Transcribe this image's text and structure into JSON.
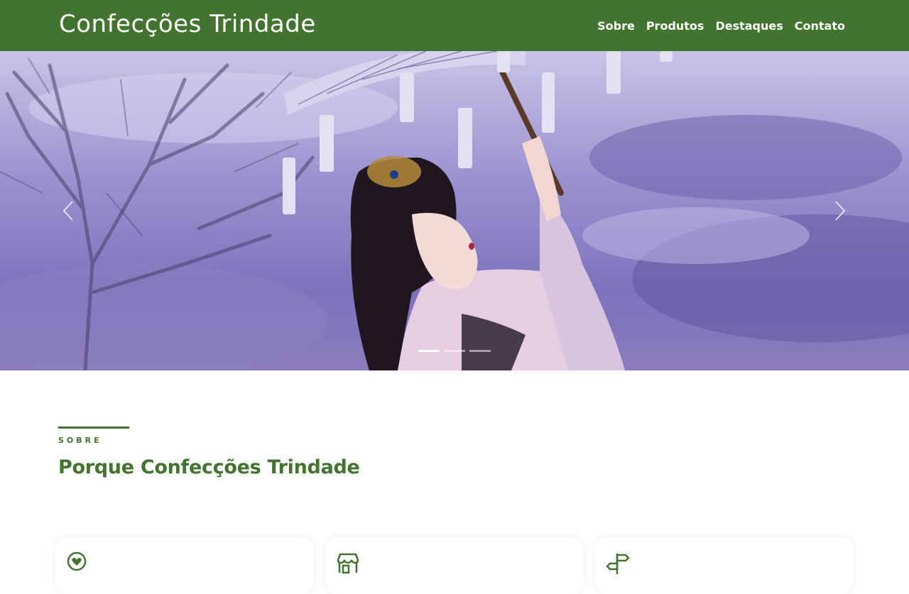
{
  "header": {
    "brand": "Confecções Trindade",
    "nav": [
      {
        "label": "Sobre"
      },
      {
        "label": "Produtos"
      },
      {
        "label": "Destaques"
      },
      {
        "label": "Contato"
      }
    ]
  },
  "hero": {
    "slides_count": 3,
    "active_slide": 1,
    "prev_icon": "chevron-left-icon",
    "next_icon": "chevron-right-icon"
  },
  "about": {
    "eyebrow": "SOBRE",
    "title": "Porque Confecções Trindade"
  },
  "cards": [
    {
      "icon": "heart-location-icon"
    },
    {
      "icon": "store-icon"
    },
    {
      "icon": "signpost-icon"
    }
  ],
  "colors": {
    "brand_green": "#42742f",
    "white": "#ffffff"
  }
}
